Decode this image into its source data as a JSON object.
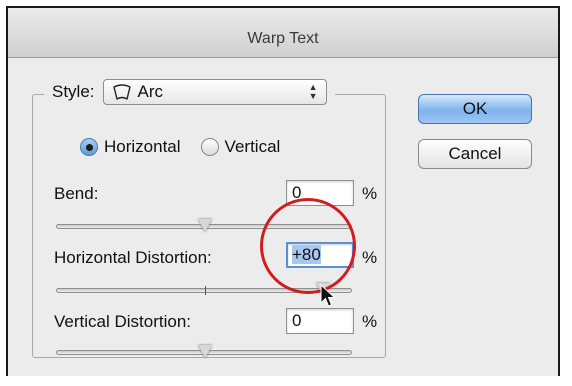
{
  "window": {
    "title": "Warp Text"
  },
  "style": {
    "label": "Style:",
    "selected": "Arc",
    "icon": "arc-warp-icon"
  },
  "orientation": {
    "options": [
      {
        "label": "Horizontal",
        "checked": true
      },
      {
        "label": "Vertical",
        "checked": false
      }
    ]
  },
  "bend": {
    "label": "Bend:",
    "value": "0",
    "unit": "%",
    "level": 0
  },
  "horizontal_distortion": {
    "label": "Horizontal Distortion:",
    "value": "+80",
    "unit": "%",
    "level": 80
  },
  "vertical_distortion": {
    "label": "Vertical Distortion:",
    "value": "0",
    "unit": "%",
    "level": 0
  },
  "buttons": {
    "ok": "OK",
    "cancel": "Cancel"
  },
  "colors": {
    "accent": "#7fb3ec",
    "highlight_circle": "#d21d1d"
  }
}
